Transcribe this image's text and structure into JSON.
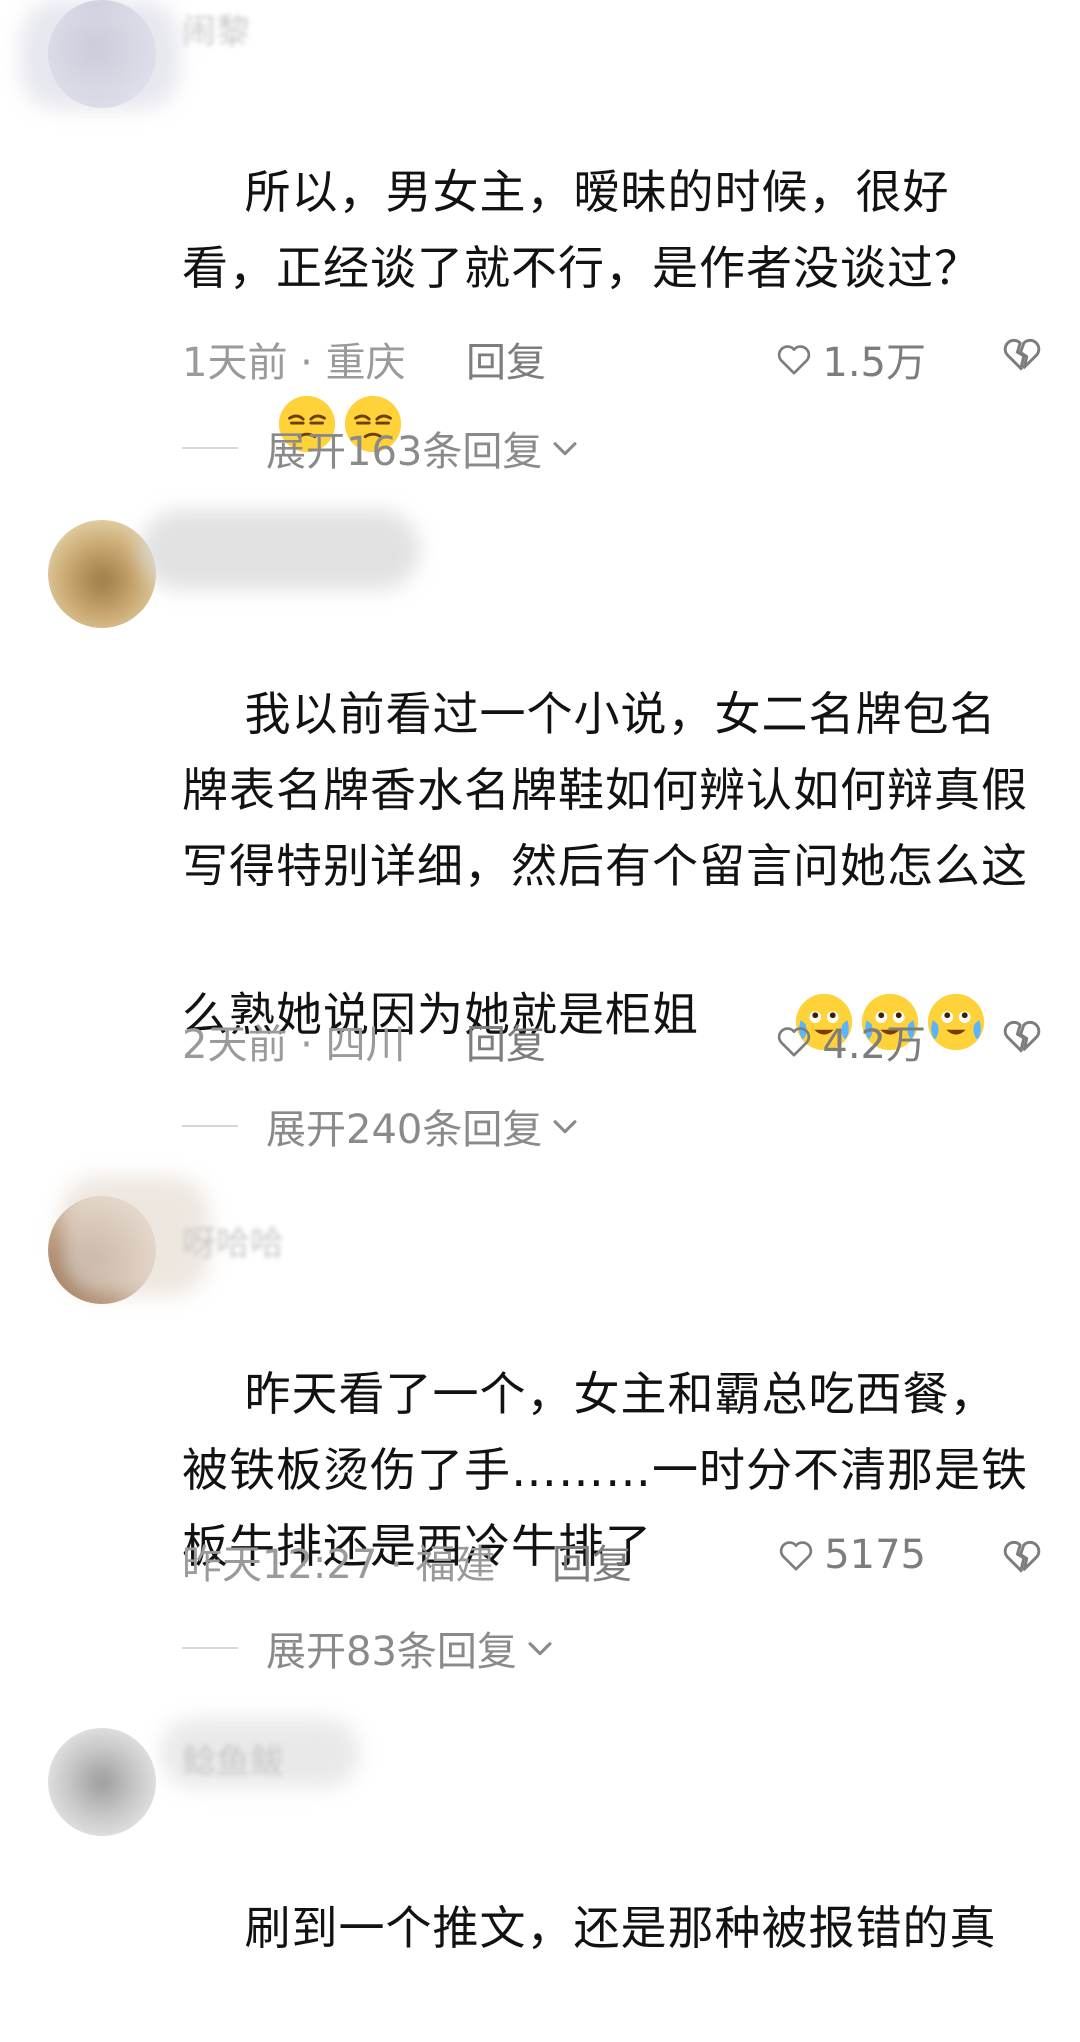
{
  "comments": [
    {
      "username": "闹黎",
      "content": "所以，男女主，暧昧的时候，很好看，正经谈了就不行，是作者没谈过？",
      "emoji": "unamused-face-emoji",
      "time": "1天前 · 重庆",
      "reply_label": "回复",
      "likes": "1.5万",
      "expand_label": "展开163条回复"
    },
    {
      "username": "",
      "content": "我以前看过一个小说，女二名牌包名牌表名牌香水名牌鞋如何辨认如何辩真假写得特别详细，然后有个留言问她怎么这么熟她说因为她就是柜姐",
      "emoji": "crying-laughing-face-emoji",
      "time": "2天前 · 四川",
      "reply_label": "回复",
      "likes": "4.2万",
      "expand_label": "展开240条回复"
    },
    {
      "username": "呀哈哈",
      "content": "昨天看了一个，女主和霸总吃西餐，被铁板烫伤了手………一时分不清那是铁板牛排还是西冷牛排了",
      "time": "昨天12:27 · 福建",
      "reply_label": "回复",
      "likes": "5175",
      "expand_label": "展开83条回复"
    },
    {
      "username": "鲶鱼鲅",
      "content": "刷到一个推文，还是那种被报错的真"
    }
  ],
  "icons": {
    "like": "heart-outline-icon",
    "dislike": "broken-heart-icon",
    "expand": "chevron-down-icon"
  },
  "colors": {
    "text": "#121212",
    "meta": "#9a9a9a",
    "action": "#7d7d7d",
    "emoji_yellow": "#FFD23A"
  }
}
